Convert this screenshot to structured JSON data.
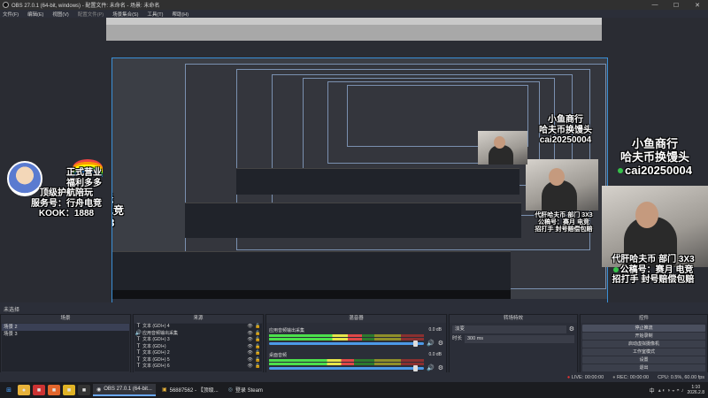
{
  "window": {
    "title": "OBS 27.0.1 (64-bit, windows) - 配置文件: 未命名 - 场景: 未命名",
    "minimize": "—",
    "maximize": "☐",
    "close": "✕"
  },
  "menu": [
    "文件(F)",
    "编辑(E)",
    "视图(V)",
    "配置文件(P)",
    "场景集合(S)",
    "工具(T)",
    "帮助(H)"
  ],
  "overlay": {
    "left_lines": [
      "正式营业",
      "福利多多",
      "顶级护航陪玩"
    ],
    "left_service": "服务号：行舟电竞",
    "left_kook": "KOOK：1888",
    "right_title": "小鱼商行",
    "right_sub": "哈夫币换馒头",
    "right_id": "cai20250004",
    "bottom_line1": "代肝哈夫币 部门 3X3",
    "bottom_line2": "公稿号：赛月 电竞",
    "bottom_line3": "招打手 封号赔偿包赔"
  },
  "scene_collection": "未选择",
  "docks": {
    "scenes": {
      "title": "场景",
      "items": [
        "场景 2",
        "场景 3"
      ],
      "selected_index": 0
    },
    "sources": {
      "title": "来源",
      "items": [
        {
          "icon": "T",
          "name": "文本 (GDI+) 4"
        },
        {
          "icon": "🔊",
          "name": "应用音频输出采集"
        },
        {
          "icon": "T",
          "name": "文本 (GDI+) 3"
        },
        {
          "icon": "T",
          "name": "文本 (GDI+)"
        },
        {
          "icon": "T",
          "name": "文本 (GDI+) 2"
        },
        {
          "icon": "T",
          "name": "文本 (GDI+) 5"
        },
        {
          "icon": "T",
          "name": "文本 (GDI+) 6"
        }
      ]
    },
    "mixer": {
      "title": "混音器",
      "channels": [
        {
          "name": "应用音频输出采集",
          "db": "0.0 dB",
          "level": 0.6,
          "volume": 0.95
        },
        {
          "name": "桌面音频",
          "db": "0.0 dB",
          "level": 0.55,
          "volume": 0.95
        }
      ]
    },
    "transitions": {
      "title": "转场特效",
      "type": "淡变",
      "duration_label": "时长",
      "duration": "300 ms"
    },
    "controls": {
      "title": "控件",
      "buttons": [
        "停止推流",
        "开始录制",
        "启动虚拟摄像机",
        "工作室模式",
        "设置",
        "退出"
      ],
      "active_index": 0
    }
  },
  "status": {
    "live": "LIVE: 00:00:00",
    "rec": "REC: 00:00:00",
    "cpu": "CPU: 0.5%, 60.00 fps"
  },
  "taskbar": {
    "apps": [
      {
        "label": "OBS 27.0.1 (64-bit...",
        "active": true
      },
      {
        "label": "56887562 - 【顶级...",
        "active": false
      },
      {
        "label": "登录 Steam",
        "active": false
      }
    ],
    "ime": "中",
    "time": "1:10",
    "date": "2026.2.8"
  }
}
